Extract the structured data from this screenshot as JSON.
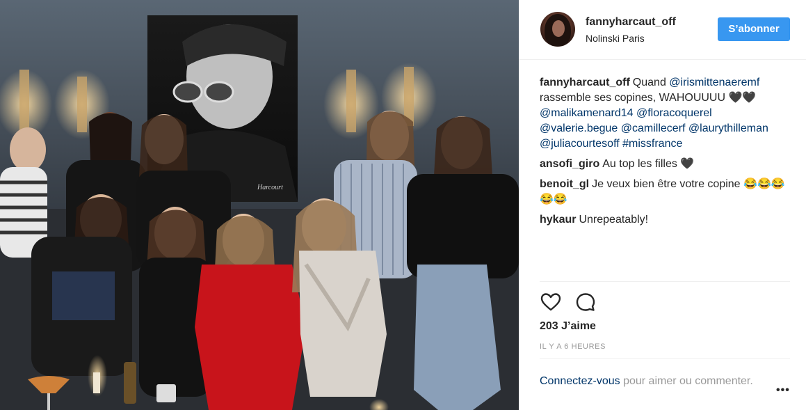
{
  "post": {
    "username": "fannyharcaut_off",
    "location": "Nolinski Paris",
    "follow_label": "S’abonner",
    "caption": {
      "user": "fannyharcaut_off",
      "parts": [
        {
          "text": "Quand ",
          "type": "text"
        },
        {
          "text": "@irismittenaeremf",
          "type": "mention"
        },
        {
          "text": " rassemble ses copines, WAHOUUUU 🖤🖤 ",
          "type": "text"
        },
        {
          "text": "@malikamenard14",
          "type": "mention"
        },
        {
          "text": " ",
          "type": "text"
        },
        {
          "text": "@floracoquerel",
          "type": "mention"
        },
        {
          "text": " ",
          "type": "text"
        },
        {
          "text": "@valerie.begue",
          "type": "mention"
        },
        {
          "text": " ",
          "type": "text"
        },
        {
          "text": "@camillecerf",
          "type": "mention"
        },
        {
          "text": " ",
          "type": "text"
        },
        {
          "text": "@laurythilleman",
          "type": "mention"
        },
        {
          "text": " ",
          "type": "text"
        },
        {
          "text": "@juliacourtesoff",
          "type": "mention"
        },
        {
          "text": " ",
          "type": "text"
        },
        {
          "text": "#missfrance",
          "type": "mention"
        }
      ]
    },
    "comments": [
      {
        "user": "ansofi_giro",
        "text": "Au top les filles 🖤"
      },
      {
        "user": "benoit_gl",
        "text": "Je veux bien être votre copine 😂😂😂😂😂"
      },
      {
        "user": "hykaur",
        "text": "Unrepeatably!"
      }
    ],
    "likes": "203 J’aime",
    "time": "IL Y A 6 HEURES",
    "login_link": "Connectez-vous",
    "login_text": " pour aimer ou commenter.",
    "more_label": "•••",
    "icons": {
      "like": "heart-outline-icon",
      "comment": "speech-bubble-icon",
      "more": "ellipsis-icon"
    },
    "colors": {
      "follow_button": "#3897f0",
      "mention": "#003569",
      "muted": "#999999"
    }
  }
}
